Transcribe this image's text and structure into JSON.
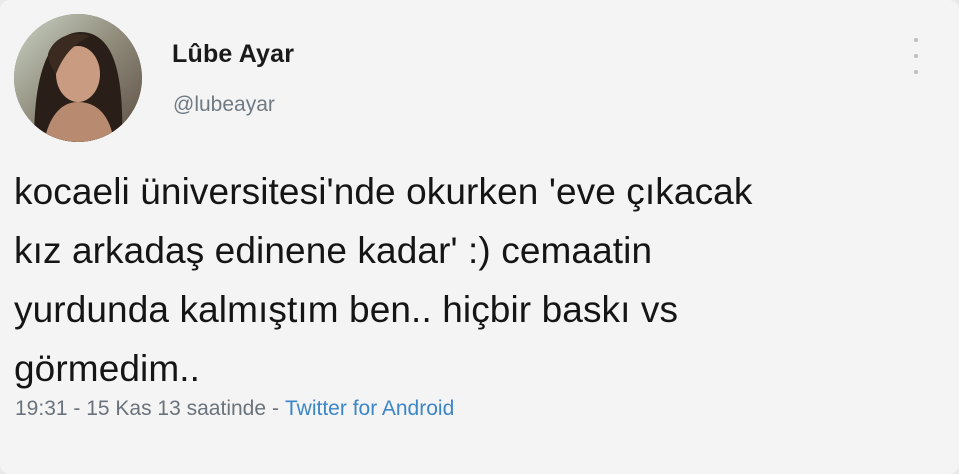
{
  "tweet": {
    "display_name": "Lûbe Ayar",
    "handle": "@lubeayar",
    "text_lines": [
      "kocaeli üniversitesi'nde okurken 'eve çıkacak",
      "kız arkadaş edinene kadar' :) cemaatin",
      "yurdunda kalmıştım ben.. hiçbir baskı vs",
      "görmedim.."
    ],
    "timestamp": "19:31 - 15 Kas 13 saatinde",
    "separator": "-",
    "source": "Twitter for Android"
  },
  "icons": {
    "more": "more-vertical-icon",
    "avatar": "user-avatar"
  },
  "colors": {
    "background": "#f4f4f4",
    "text": "#151515",
    "secondary": "#6f7a83",
    "link": "#3c86c7"
  }
}
